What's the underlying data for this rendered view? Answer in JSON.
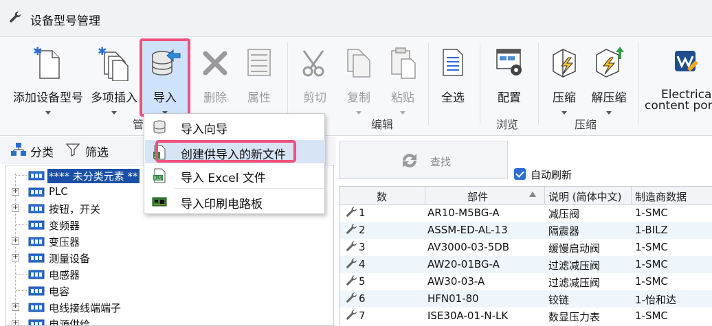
{
  "window": {
    "title": "设备型号管理"
  },
  "ribbon": {
    "add_model": "添加设备型号",
    "multi_insert": "多项插入",
    "import": "导入",
    "delete": "删除",
    "properties": "属性",
    "cut": "剪切",
    "copy": "复制",
    "paste": "粘贴",
    "select_all": "全选",
    "configure": "配置",
    "compress": "压缩",
    "decompress": "解压缩",
    "electrical_content_line1": "Electrical",
    "electrical_content_line2": "content por",
    "group_manage": "管",
    "group_edit": "编辑",
    "group_browse": "浏览",
    "group_compress": "压缩"
  },
  "import_menu": {
    "items": [
      {
        "label": "导入向导",
        "icon": "database-icon"
      },
      {
        "label": "创建供导入的新文件",
        "icon": "new-file-icon"
      },
      {
        "label": "导入 Excel 文件",
        "icon": "excel-icon"
      },
      {
        "label": "导入印刷电路板",
        "icon": "pcb-icon"
      }
    ]
  },
  "left_panel": {
    "tab_category": "分类",
    "tab_filter": "筛选",
    "tree": [
      {
        "label": "**** 未分类元素 **",
        "expandable": false,
        "selected": true
      },
      {
        "label": "PLC",
        "expandable": true
      },
      {
        "label": "按钮，开关",
        "expandable": true
      },
      {
        "label": "变频器",
        "expandable": false
      },
      {
        "label": "变压器",
        "expandable": true
      },
      {
        "label": "测量设备",
        "expandable": true
      },
      {
        "label": "电感器",
        "expandable": false
      },
      {
        "label": "电容",
        "expandable": false
      },
      {
        "label": "电线接线端端子",
        "expandable": true
      },
      {
        "label": "电源供给",
        "expandable": true
      }
    ]
  },
  "search": {
    "label": "查找",
    "auto_refresh": "自动刷新"
  },
  "grid": {
    "columns": [
      "数",
      "部件",
      "说明 (简体中文)",
      "制造商数据"
    ],
    "rows": [
      {
        "n": "1",
        "part": "AR10-M5BG-A",
        "desc": "减压阀",
        "mfr": "1-SMC"
      },
      {
        "n": "2",
        "part": "ASSM-ED-AL-13",
        "desc": "隔震器",
        "mfr": "1-BILZ"
      },
      {
        "n": "3",
        "part": "AV3000-03-5DB",
        "desc": "缓慢启动阀",
        "mfr": "1-SMC"
      },
      {
        "n": "4",
        "part": "AW20-01BG-A",
        "desc": "过滤减压阀",
        "mfr": "1-SMC"
      },
      {
        "n": "5",
        "part": "AW30-03-A",
        "desc": "过滤减压阀",
        "mfr": "1-SMC"
      },
      {
        "n": "6",
        "part": "HFN01-80",
        "desc": "铰链",
        "mfr": "1-怡和达"
      },
      {
        "n": "7",
        "part": "ISE30A-01-N-LK",
        "desc": "数显压力表",
        "mfr": "1-SMC"
      }
    ]
  },
  "colors": {
    "highlight": "#f0507a",
    "selection": "#1a4fa8",
    "accent": "#2a6ed4"
  }
}
